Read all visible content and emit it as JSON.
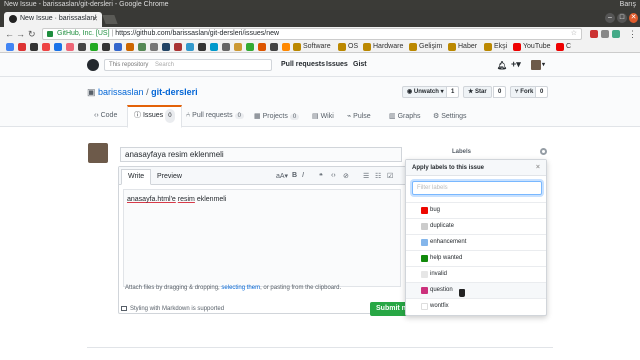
{
  "os": {
    "title": "New Issue - barissaslan/git-dersleri - Google Chrome",
    "user": "Barış"
  },
  "tab": {
    "label": "New Issue · barissaslan/"
  },
  "omnibox": {
    "secure_label": "GitHub, Inc. [US]",
    "url": "https://github.com/barissaslan/git-dersleri/issues/new"
  },
  "bookmarks": [
    "Software",
    "OS",
    "Hardware",
    "Gelişim",
    "Haber",
    "Ekşi",
    "YouTube",
    "C"
  ],
  "github": {
    "search_scope": "This repository",
    "search_placeholder": "Search",
    "nav": [
      "Pull requests",
      "Issues",
      "Gist"
    ]
  },
  "repo": {
    "owner": "barissaslan",
    "separator": "/",
    "name": "git-dersleri",
    "watch_label": "Unwatch",
    "watch_count": "1",
    "star_label": "Star",
    "star_count": "0",
    "fork_label": "Fork",
    "fork_count": "0",
    "tabs": [
      {
        "label": "Code"
      },
      {
        "label": "Issues",
        "count": "0"
      },
      {
        "label": "Pull requests",
        "count": "0"
      },
      {
        "label": "Projects",
        "count": "0"
      },
      {
        "label": "Wiki"
      },
      {
        "label": "Pulse"
      },
      {
        "label": "Graphs"
      },
      {
        "label": "Settings"
      }
    ]
  },
  "issue": {
    "title_value": "anasayfaya resim eklenmeli",
    "write_tab": "Write",
    "preview_tab": "Preview",
    "body_link_text": "anasayfa.html'e",
    "body_word": "resim",
    "body_rest": "eklenmeli",
    "attach_text_before": "Attach files by dragging & dropping, ",
    "attach_link": "selecting them",
    "attach_text_after": ", or pasting from the clipboard.",
    "markdown_note": "Styling with Markdown is supported",
    "submit_label": "Submit new issue"
  },
  "sidebar": {
    "labels_title": "Labels"
  },
  "labels_popup": {
    "title": "Apply labels to this issue",
    "close": "×",
    "filter_placeholder": "Filter labels",
    "labels": [
      {
        "name": "bug",
        "color": "#ee0701"
      },
      {
        "name": "duplicate",
        "color": "#cccccc"
      },
      {
        "name": "enhancement",
        "color": "#84b6eb"
      },
      {
        "name": "help wanted",
        "color": "#128a0c"
      },
      {
        "name": "invalid",
        "color": "#e6e6e6"
      },
      {
        "name": "question",
        "color": "#cc317c"
      },
      {
        "name": "wontfix",
        "color": "#ffffff"
      }
    ]
  }
}
